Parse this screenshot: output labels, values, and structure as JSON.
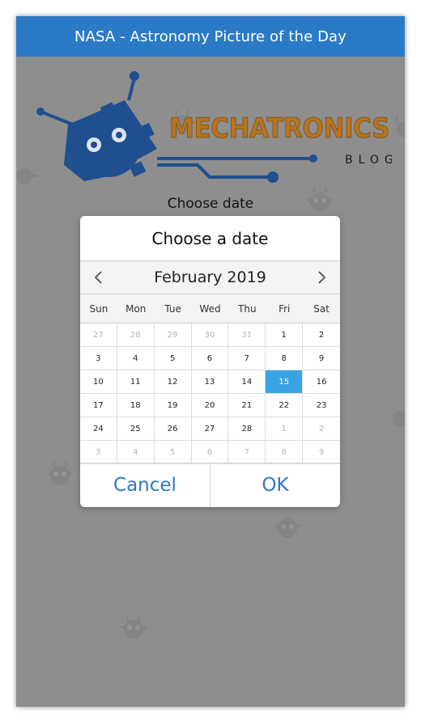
{
  "app": {
    "title": "NASA - Astronomy Picture of the Day"
  },
  "logo": {
    "brand": "MECHATRONICS",
    "sub": "BLOG"
  },
  "screen": {
    "prompt_label": "Choose date"
  },
  "dialog": {
    "title": "Choose a date",
    "month_label": "February 2019",
    "weekdays": [
      "Sun",
      "Mon",
      "Tue",
      "Wed",
      "Thu",
      "Fri",
      "Sat"
    ],
    "days": [
      {
        "label": "27",
        "muted": true
      },
      {
        "label": "28",
        "muted": true
      },
      {
        "label": "29",
        "muted": true
      },
      {
        "label": "30",
        "muted": true
      },
      {
        "label": "31",
        "muted": true
      },
      {
        "label": "1"
      },
      {
        "label": "2"
      },
      {
        "label": "3"
      },
      {
        "label": "4"
      },
      {
        "label": "5"
      },
      {
        "label": "6"
      },
      {
        "label": "7"
      },
      {
        "label": "8"
      },
      {
        "label": "9"
      },
      {
        "label": "10"
      },
      {
        "label": "11"
      },
      {
        "label": "12"
      },
      {
        "label": "13"
      },
      {
        "label": "14"
      },
      {
        "label": "15",
        "selected": true
      },
      {
        "label": "16"
      },
      {
        "label": "17"
      },
      {
        "label": "18"
      },
      {
        "label": "19"
      },
      {
        "label": "20"
      },
      {
        "label": "21"
      },
      {
        "label": "22"
      },
      {
        "label": "23"
      },
      {
        "label": "24"
      },
      {
        "label": "25"
      },
      {
        "label": "26"
      },
      {
        "label": "27"
      },
      {
        "label": "28"
      },
      {
        "label": "1",
        "muted": true
      },
      {
        "label": "2",
        "muted": true
      },
      {
        "label": "3",
        "muted": true
      },
      {
        "label": "4",
        "muted": true
      },
      {
        "label": "5",
        "muted": true
      },
      {
        "label": "6",
        "muted": true
      },
      {
        "label": "7",
        "muted": true
      },
      {
        "label": "8",
        "muted": true
      },
      {
        "label": "9",
        "muted": true
      }
    ],
    "cancel_label": "Cancel",
    "ok_label": "OK"
  },
  "colors": {
    "appbar": "#2b7ac6",
    "overlay": "#8e8e8e",
    "accent_blue": "#2f78c0",
    "selected_day": "#3aa3e3",
    "logo_blue": "#1f4f8f",
    "logo_orange": "#b9741f"
  },
  "icons": [
    "chevron-left-icon",
    "chevron-right-icon",
    "mechatronics-logo"
  ]
}
